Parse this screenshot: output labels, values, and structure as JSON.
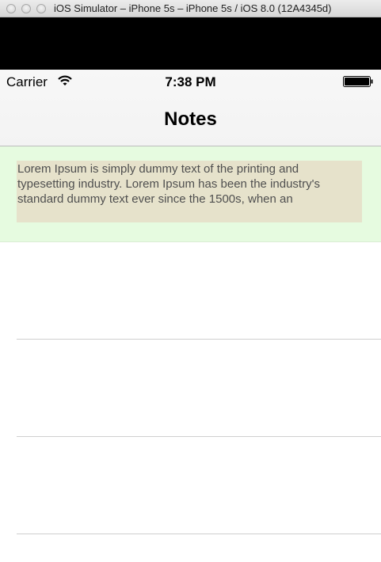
{
  "window": {
    "title": "iOS Simulator – iPhone 5s – iPhone 5s / iOS 8.0 (12A4345d)"
  },
  "status_bar": {
    "carrier": "Carrier",
    "time": "7:38 PM",
    "icons": [
      "wifi-icon",
      "battery-icon"
    ]
  },
  "nav": {
    "title": "Notes"
  },
  "notes": [
    {
      "text": "Lorem Ipsum is simply dummy text of the printing and typesetting industry. Lorem Ipsum has been the industry's standard dummy text ever since the 1500s, when an"
    }
  ],
  "colors": {
    "selected_row": "#e6fbe0",
    "text_highlight": "#e6e2cb",
    "separator": "#cfcfcf"
  }
}
